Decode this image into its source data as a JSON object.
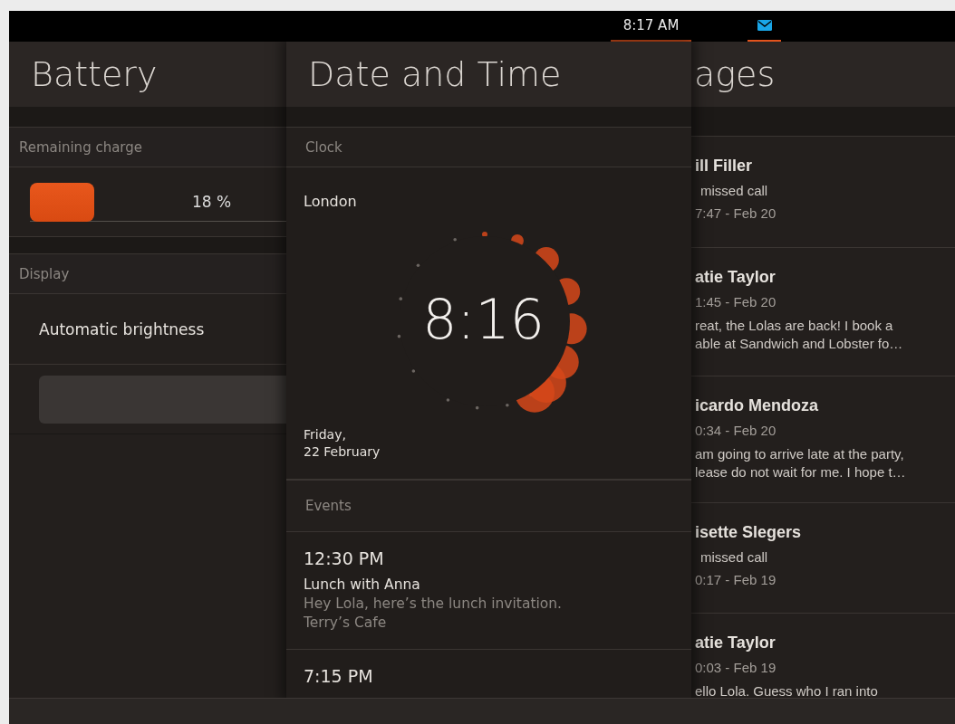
{
  "status_bar": {
    "time": "8:17 AM"
  },
  "battery": {
    "title": "Battery",
    "charge_header": "Remaining charge",
    "charge": {
      "level": 0.18,
      "reading": "18 %"
    },
    "display_header": "Display",
    "auto_brightness": "Automatic brightness"
  },
  "date_time": {
    "title": "Date and Time",
    "clock_header": "Clock",
    "city": "London",
    "time": "8:16",
    "date": "Friday,\n22 February",
    "events_header": "Events",
    "events": [
      {
        "time": "12:30 PM",
        "title": "Lunch with Anna",
        "description": "Hey Lola, here’s the lunch invitation.",
        "location": "Terry’s Cafe"
      },
      {
        "time": "7:15 PM"
      }
    ]
  },
  "messages": {
    "title": "ages",
    "items": [
      {
        "kind": "call",
        "name": "ill Filler",
        "note": "missed call",
        "time": "7:47 - Feb 20"
      },
      {
        "kind": "message",
        "name": "atie Taylor",
        "time": "1:45 - Feb 20",
        "preview": "reat, the Lolas are back! I book a\nable at Sandwich and Lobster fo…"
      },
      {
        "kind": "message",
        "name": "icardo Mendoza",
        "time": "0:34 - Feb 20",
        "preview": "am going to arrive late at the party,\nlease do not wait for me. I hope t…"
      },
      {
        "kind": "call",
        "name": "isette Slegers",
        "note": "missed call",
        "time": "0:17 - Feb 19"
      },
      {
        "kind": "message",
        "name": "atie Taylor",
        "time": "0:03 - Feb 19",
        "preview": "ello Lola. Guess who I ran into"
      }
    ]
  }
}
